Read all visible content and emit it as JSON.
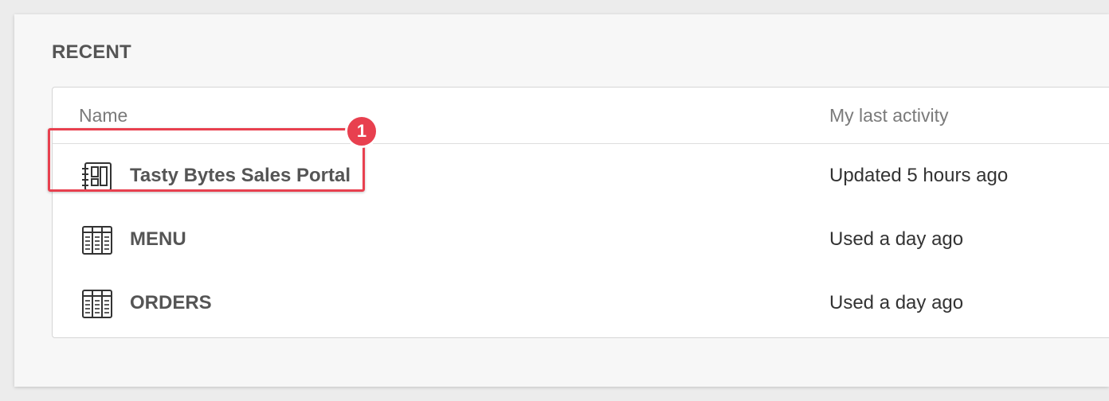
{
  "section": {
    "title": "RECENT"
  },
  "table": {
    "columns": {
      "name": "Name",
      "activity": "My last activity"
    },
    "rows": [
      {
        "name": "Tasty Bytes Sales Portal",
        "activity": "Updated 5 hours ago",
        "icon": "workbook-icon"
      },
      {
        "name": "MENU",
        "activity": "Used a day ago",
        "icon": "table-icon"
      },
      {
        "name": "ORDERS",
        "activity": "Used a day ago",
        "icon": "table-icon"
      }
    ]
  },
  "annotation": {
    "badge": "1",
    "color": "#e8404f"
  }
}
